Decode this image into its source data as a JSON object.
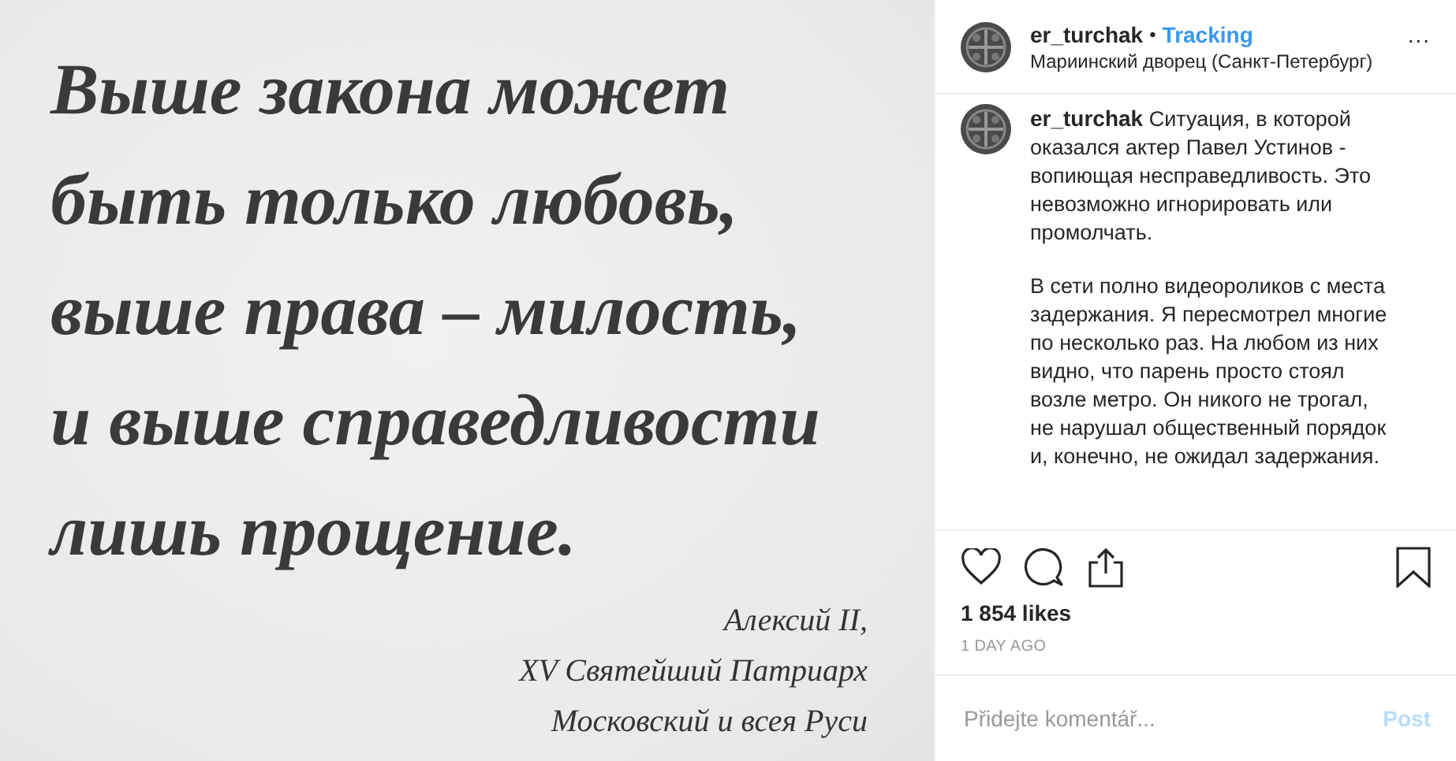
{
  "post_image": {
    "kind": "quote",
    "quote_lines": [
      "Выше закона может",
      "быть только любовь,",
      "выше права – милость,",
      "и выше справедливости",
      "лишь прощение."
    ],
    "attribution_lines": [
      "Алексий II,",
      "XV Святейший Патриарх",
      "Московский и всея Руси"
    ]
  },
  "header": {
    "username": "er_turchak",
    "separator": "•",
    "follow": "Tracking",
    "location": "Мариинский дворец (Санкт-Петербург)",
    "more": "..."
  },
  "caption": {
    "username": "er_turchak",
    "paragraphs": [
      "Ситуация, в которой оказался актер Павел Устинов - вопиющая несправедливость. Это невозможно игнорировать или промолчать.",
      "В сети полно видеороликов с места задержания. Я пересмотрел многие по несколько раз. На любом из них видно, что парень просто стоял возле метро. Он никого не трогал, не нарушал общественный порядок и, конечно, не ожидал задержания."
    ]
  },
  "actions": {
    "liked": false,
    "saved": false
  },
  "likes": "1 854 likes",
  "time": "1 DAY AGO",
  "comment": {
    "placeholder": "Přidejte komentář...",
    "post_button": "Post",
    "post_enabled": false
  }
}
